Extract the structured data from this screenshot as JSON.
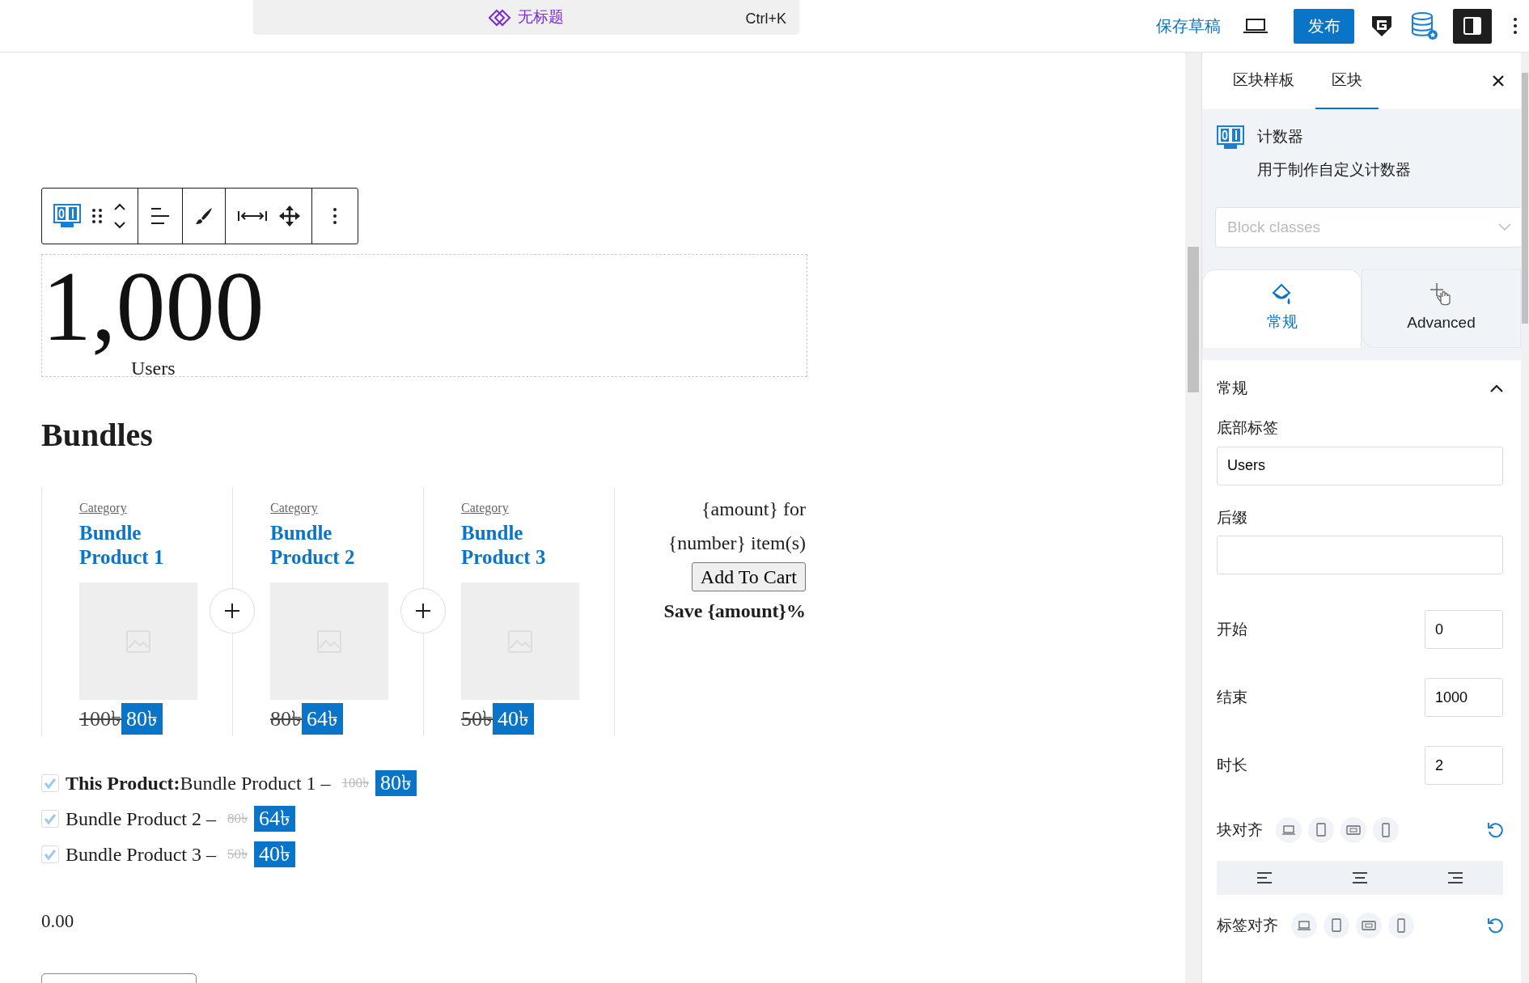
{
  "topbar": {
    "document_title": "无标题",
    "shortcut": "Ctrl+K",
    "save_draft": "保存草稿",
    "publish": "发布"
  },
  "counter": {
    "number": "1,000",
    "label": "Users"
  },
  "bundles": {
    "heading": "Bundles",
    "products": [
      {
        "category": "Category",
        "name": "Bundle Product 1",
        "old_price": "100৳",
        "price": "80৳"
      },
      {
        "category": "Category",
        "name": "Bundle Product 2",
        "old_price": "80৳",
        "price": "64৳"
      },
      {
        "category": "Category",
        "name": "Bundle Product 3",
        "old_price": "50৳",
        "price": "40৳"
      }
    ],
    "summary": {
      "lines": [
        "{amount} for",
        "{number} item(s)"
      ],
      "button": "Add To Cart",
      "save": "Save {amount}%"
    },
    "checklist": [
      {
        "text": "**This Product:**Bundle Product 1 –",
        "old_price": "100৳",
        "price": "80৳",
        "checked": true
      },
      {
        "text": "Bundle Product 2 –",
        "old_price": "80৳",
        "price": "64৳",
        "checked": true
      },
      {
        "text": "Bundle Product 3 –",
        "old_price": "50৳",
        "price": "40৳",
        "checked": true
      }
    ],
    "total": "0.00"
  },
  "sidebar": {
    "tabs": [
      {
        "label": "区块样板",
        "selected": false
      },
      {
        "label": "区块",
        "selected": true
      }
    ],
    "block": {
      "name": "计数器",
      "description": "用于制作自定义计数器"
    },
    "block_classes": {
      "placeholder": "Block classes"
    },
    "panel_tabs": [
      {
        "label": "常规",
        "selected": true
      },
      {
        "label": "Advanced",
        "selected": false
      }
    ],
    "section": {
      "title": "常规",
      "expanded": true,
      "fields": [
        {
          "kind": "text",
          "label": "底部标签",
          "value": "Users"
        },
        {
          "kind": "text",
          "label": "后缀"
        },
        {
          "kind": "number",
          "label": "开始",
          "value": "0"
        },
        {
          "kind": "number",
          "label": "结束",
          "value": "1000"
        },
        {
          "kind": "number",
          "label": "时长",
          "value": "2"
        },
        {
          "kind": "align",
          "label": "块对齐",
          "options_bar": true
        },
        {
          "kind": "align",
          "label": "标签对齐",
          "options_bar": false
        }
      ]
    }
  }
}
